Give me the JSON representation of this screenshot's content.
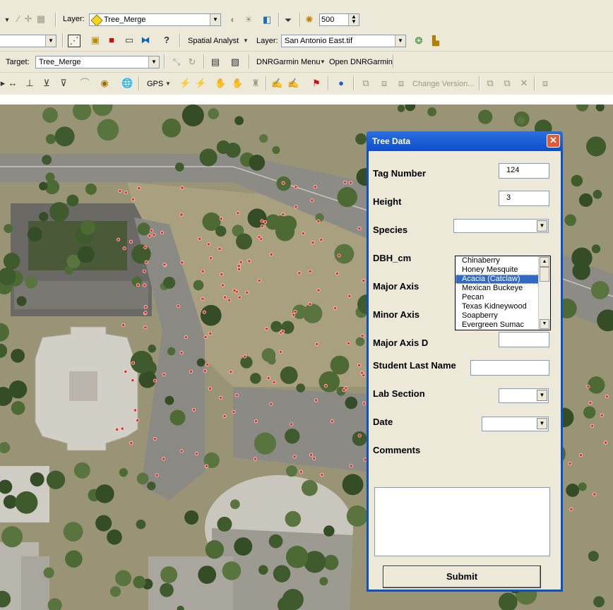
{
  "toolbar1": {
    "layer_label": "Layer:",
    "layer_value": "Tree_Merge",
    "zoom_value": "500"
  },
  "toolbar2": {
    "spatial_analyst_label": "Spatial Analyst",
    "layer_label": "Layer:",
    "layer_value": "San Antonio East.tif"
  },
  "toolbar3": {
    "target_label": "Target:",
    "target_value": "Tree_Merge",
    "dnrgarmin_menu": "DNRGarmin Menu",
    "open_dnrgarmin": "Open DNRGarmin"
  },
  "toolbar4": {
    "gps_label": "GPS",
    "change_version": "Change Version..."
  },
  "dialog": {
    "title": "Tree Data",
    "close_glyph": "✕",
    "fields": {
      "tag_number": {
        "label": "Tag Number",
        "value": "124"
      },
      "height": {
        "label": "Height",
        "value": "3"
      },
      "species": {
        "label": "Species",
        "value": ""
      },
      "dbh": {
        "label": "DBH_cm"
      },
      "major_axis": {
        "label": "Major Axis"
      },
      "minor_axis": {
        "label": "Minor Axis"
      },
      "major_axis_d": {
        "label": "Major Axis D"
      },
      "student_last_name": {
        "label": "Student Last Name"
      },
      "lab_section": {
        "label": "Lab Section"
      },
      "date": {
        "label": "Date"
      },
      "comments": {
        "label": "Comments"
      }
    },
    "species_options": [
      "Chinaberry",
      "Honey Mesquite",
      "Acacia (Catclaw)",
      "Mexican Buckeye",
      "Pecan",
      "Texas Kidneywood",
      "Soapberry",
      "Evergreen Sumac"
    ],
    "species_highlighted": "Acacia (Catclaw)",
    "submit_label": "Submit"
  },
  "colors": {
    "title_bar": "#0c4fcc",
    "selection": "#316ac5",
    "point_marker": "#e8302a"
  }
}
